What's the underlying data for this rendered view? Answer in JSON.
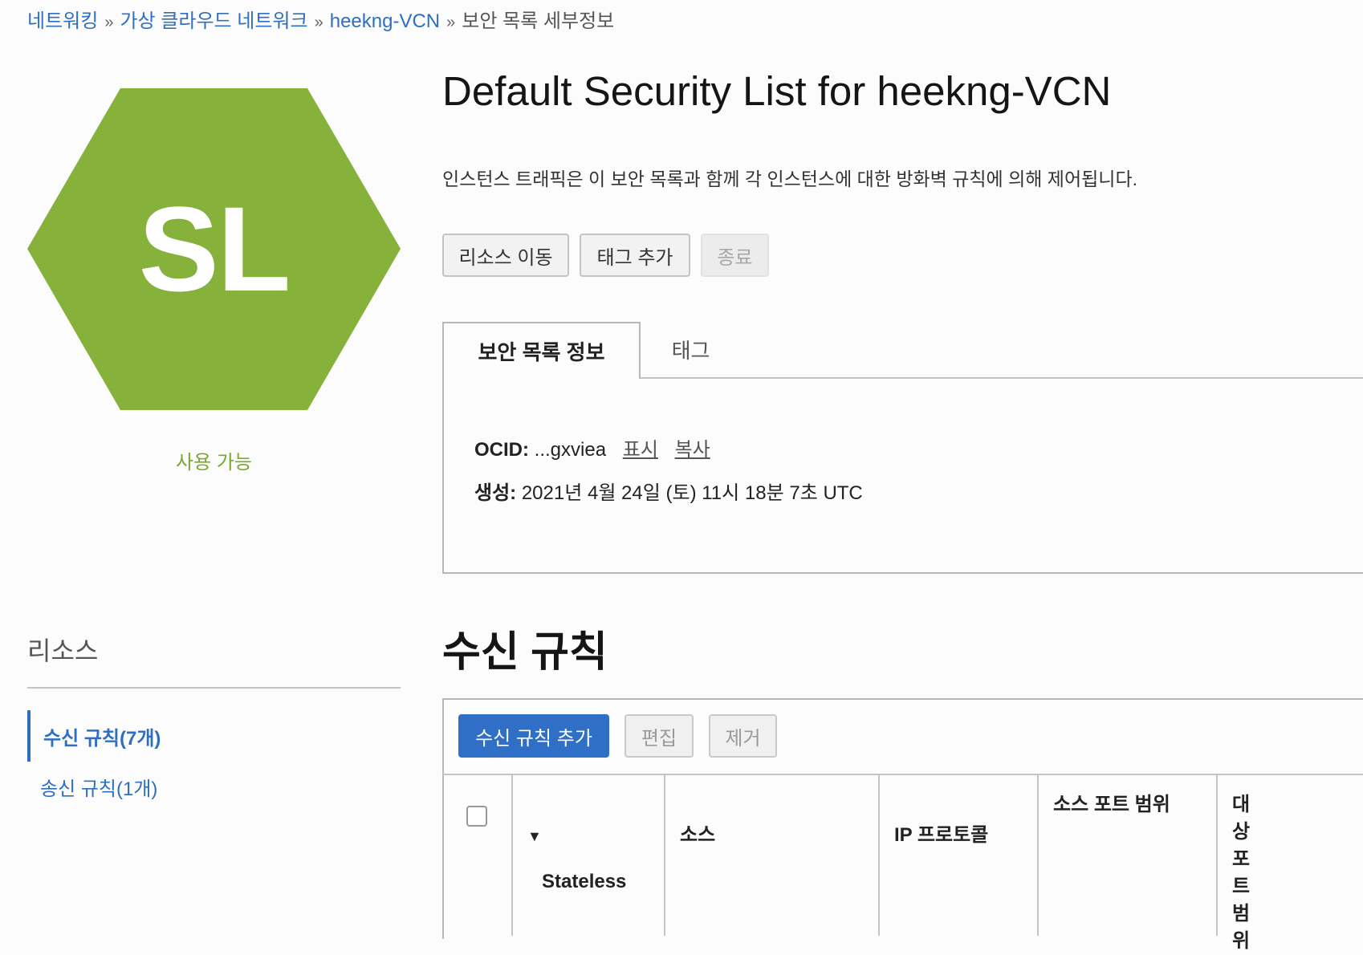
{
  "breadcrumb": [
    {
      "label": "네트워킹",
      "link": true
    },
    {
      "label": "가상 클라우드 네트워크",
      "link": true
    },
    {
      "label": "heekng-VCN",
      "link": true
    },
    {
      "label": "보안 목록 세부정보",
      "link": false
    }
  ],
  "breadcrumb_separator": "»",
  "resource_icon": {
    "text": "SL",
    "color": "#86b23b",
    "icon": "hexagon-icon"
  },
  "status": {
    "label": "사용 가능",
    "color": "#7aa92d"
  },
  "page_title": "Default Security List for heekng-VCN",
  "description": "인스턴스 트래픽은 이 보안 목록과 함께 각 인스턴스에 대한 방화벽 규칙에 의해 제어됩니다.",
  "actions": {
    "move_label": "리소스 이동",
    "tag_label": "태그 추가",
    "terminate_label": "종료"
  },
  "tabs": [
    {
      "label": "보안 목록 정보",
      "active": true
    },
    {
      "label": "태그",
      "active": false
    }
  ],
  "info": {
    "ocid_label": "OCID:",
    "ocid_value": "...gxviea",
    "show_label": "표시",
    "copy_label": "복사",
    "created_label": "생성:",
    "created_value": "2021년 4월 24일 (토) 11시 18분 7초 UTC"
  },
  "resources": {
    "title": "리소스",
    "items": [
      {
        "label": "수신 규칙(7개)",
        "active": true
      },
      {
        "label": "송신 규칙(1개)",
        "active": false
      }
    ]
  },
  "ingress": {
    "title": "수신 규칙",
    "add_label": "수신 규칙 추가",
    "edit_label": "편집",
    "remove_label": "제거",
    "columns": [
      "Stateless",
      "소스",
      "IP 프로토콜",
      "소스 포트 범위",
      "대상 포트 범위"
    ]
  },
  "colors": {
    "link": "#2f6fc0",
    "primary_button": "#2f6fc5",
    "hexagon": "#86b23b"
  }
}
